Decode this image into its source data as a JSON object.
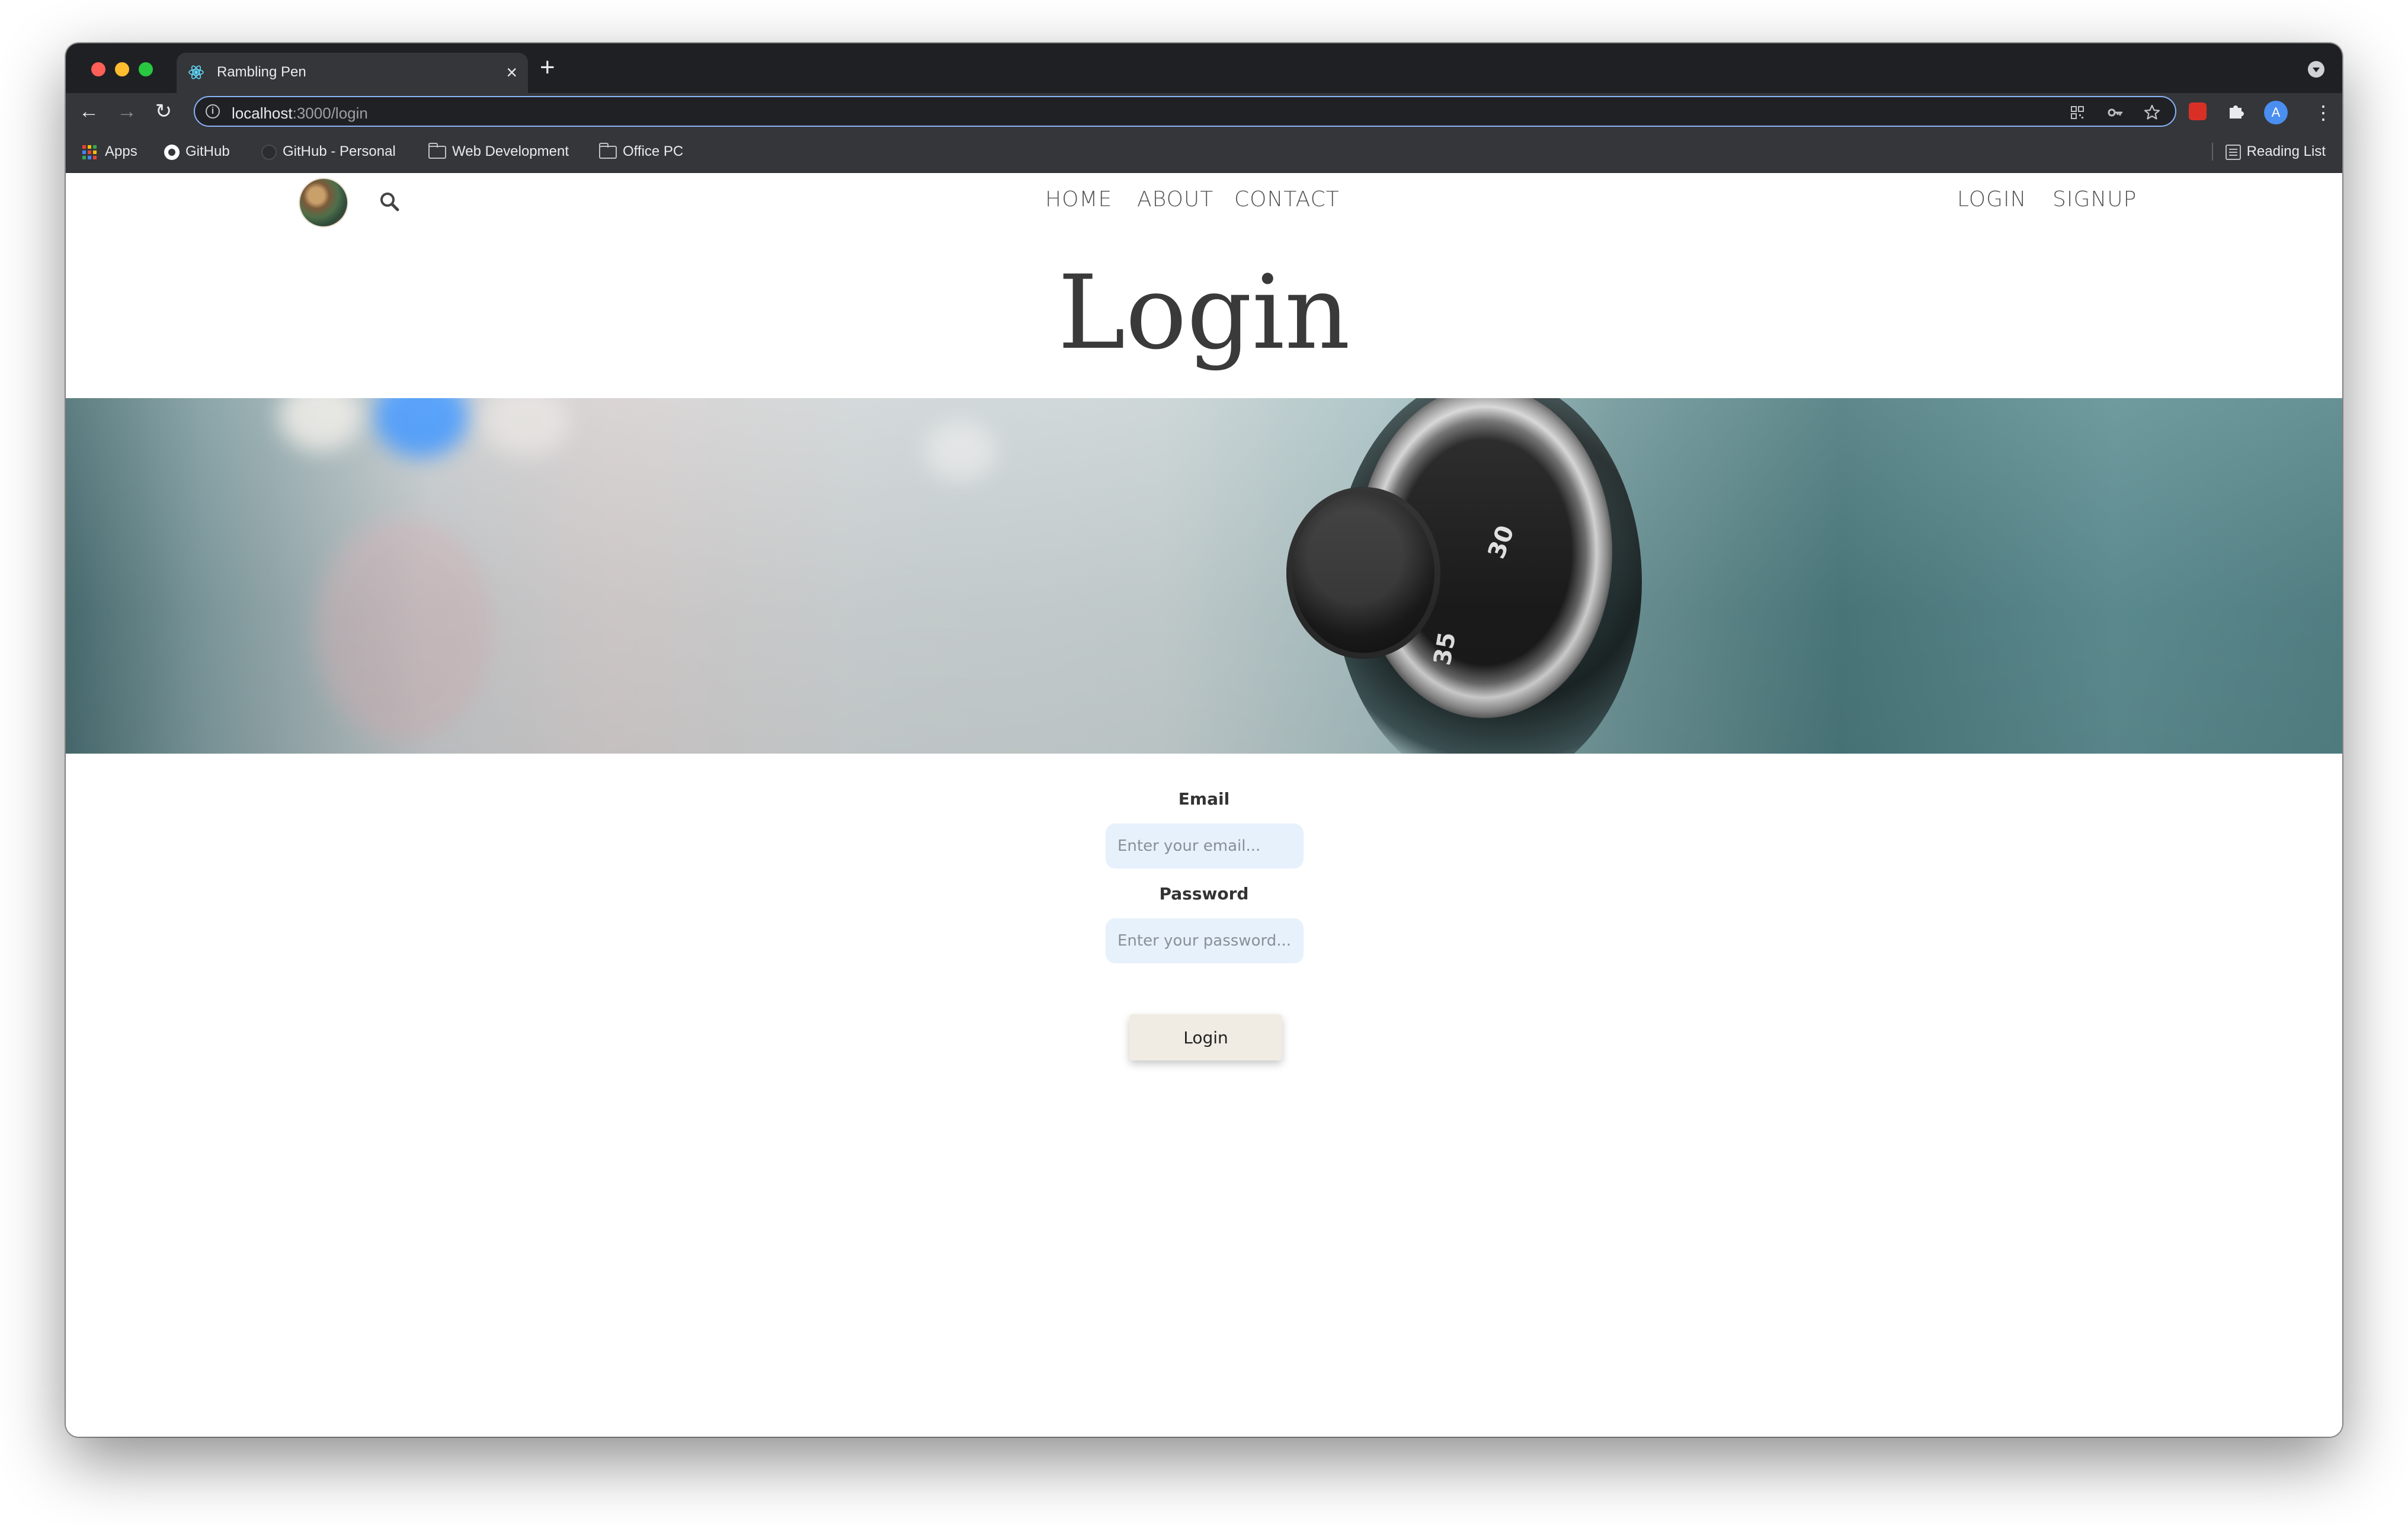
{
  "browser": {
    "tab_title": "Rambling Pen",
    "new_tab_symbol": "+",
    "close_symbol": "×",
    "url_host": "localhost",
    "url_path": ":3000/login",
    "profile_initial": "A",
    "bookmarks": {
      "apps": "Apps",
      "github": "GitHub",
      "github_personal": "GitHub - Personal",
      "web_development": "Web Development",
      "office_pc": "Office PC",
      "reading_list": "Reading List"
    }
  },
  "site": {
    "nav": {
      "home": "HOME",
      "about": "ABOUT",
      "contact": "CONTACT",
      "login": "LOGIN",
      "signup": "SIGNUP"
    },
    "page_title": "Login",
    "hero_dial_numbers": [
      "30",
      "35"
    ],
    "form": {
      "email_label": "Email",
      "email_placeholder": "Enter your email...",
      "password_label": "Password",
      "password_placeholder": "Enter your password...",
      "submit_label": "Login"
    }
  },
  "colors": {
    "accent_blue": "#8ab4f8",
    "input_background": "#e6f1fc",
    "button_background": "#f0ece3"
  }
}
